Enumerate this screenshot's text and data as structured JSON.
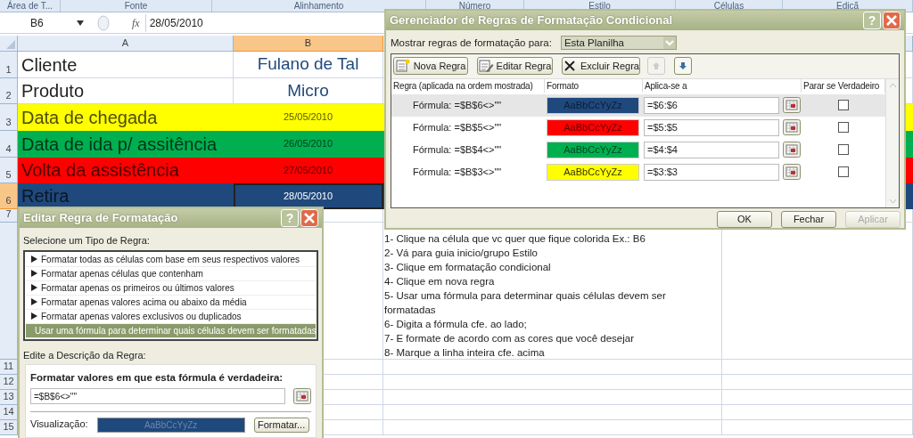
{
  "ribbon_groups": [
    {
      "label": "Área de T..."
    },
    {
      "label": "Fonte"
    },
    {
      "label": "Alinhamento"
    },
    {
      "label": "Número"
    },
    {
      "label": "Estilo"
    },
    {
      "label": "Células"
    },
    {
      "label": "Ediçã"
    }
  ],
  "formula_bar": {
    "name_box": "B6",
    "function_symbol": "fx",
    "value": "28/05/2010"
  },
  "columns": [
    {
      "label": "A",
      "selected": false
    },
    {
      "label": "B",
      "selected": true
    }
  ],
  "rows": [
    {
      "number": "1",
      "kind": "text",
      "cells": [
        "Cliente",
        "Fulano de Tal"
      ],
      "selected": false
    },
    {
      "number": "2",
      "kind": "text",
      "cells": [
        "Produto",
        "Micro"
      ],
      "selected": false
    },
    {
      "number": "3",
      "kind": "date",
      "cells": [
        "Data de chegada",
        "25/05/2010"
      ],
      "color": "#ffff00",
      "selected": false
    },
    {
      "number": "4",
      "kind": "date",
      "cells": [
        "Data de ida p/ assitência",
        "26/05/2010"
      ],
      "color": "#00b050",
      "selected": false
    },
    {
      "number": "5",
      "kind": "date",
      "cells": [
        "Volta da assistência",
        "27/05/2010"
      ],
      "color": "#ff0000",
      "selected": false
    },
    {
      "number": "6",
      "kind": "date",
      "cells": [
        "Retira",
        "28/05/2010"
      ],
      "color": "#1f497d",
      "selected": true
    },
    {
      "number": "7",
      "kind": "empty",
      "selected": false
    },
    {
      "kind": "notes",
      "selected": false,
      "notes": [
        "1- Clique na célula que vc quer que fique colorida Ex.: B6",
        "2- Vá para guia inicio/grupo Estilo",
        "3- Clique em formatação condicional",
        "4- Clique em nova regra",
        "5- Usar uma fórmula para determinar quais células devem ser formatadas",
        "6- Digita a fórmula cfe. ao lado;",
        "7- E formate de acordo com as cores que você desejar",
        "8- Marque a linha inteira cfe. acima"
      ]
    },
    {
      "number": "11",
      "kind": "empty",
      "selected": false
    },
    {
      "number": "12",
      "kind": "empty",
      "selected": false
    },
    {
      "number": "13",
      "kind": "empty",
      "selected": false
    },
    {
      "number": "14",
      "kind": "empty",
      "selected": false
    },
    {
      "number": "15",
      "kind": "empty",
      "selected": false
    }
  ],
  "rules_manager": {
    "title": "Gerenciador de Regras de Formatação Condicional",
    "help_glyph": "?",
    "show_label": "Mostrar regras de formatação para:",
    "show_value": "Esta Planilha",
    "buttons": [
      {
        "label": "Nova Regra",
        "kind": "new"
      },
      {
        "label": "Editar Regra",
        "kind": "edit"
      },
      {
        "label": "Excluir Regra",
        "kind": "delete"
      }
    ],
    "move_buttons": [
      {
        "kind": "up",
        "disabled": true
      },
      {
        "kind": "down",
        "disabled": false
      }
    ],
    "columns": [
      "Regra (aplicada na ordem mostrada)",
      "Formato",
      "Aplica-se a",
      "Parar se Verdadeiro"
    ],
    "rules": [
      {
        "rule": "Fórmula: =$B$6<>\"\"",
        "preview": "AaBbCcYyZz",
        "color": "#1f497d",
        "applies_to": "=$6:$6",
        "stop_if_true": false,
        "selected": true
      },
      {
        "rule": "Fórmula: =$B$5<>\"\"",
        "preview": "AaBbCcYyZz",
        "color": "#ff0000",
        "applies_to": "=$5:$5",
        "stop_if_true": false,
        "selected": false
      },
      {
        "rule": "Fórmula: =$B$4<>\"\"",
        "preview": "AaBbCcYyZz",
        "color": "#00b050",
        "applies_to": "=$4:$4",
        "stop_if_true": false,
        "selected": false
      },
      {
        "rule": "Fórmula: =$B$3<>\"\"",
        "preview": "AaBbCcYyZz",
        "color": "#ffff00",
        "applies_to": "=$3:$3",
        "stop_if_true": false,
        "selected": false
      }
    ],
    "footer_buttons": [
      {
        "label": "OK",
        "disabled": false
      },
      {
        "label": "Fechar",
        "disabled": false
      },
      {
        "label": "Aplicar",
        "disabled": true
      }
    ]
  },
  "edit_rule": {
    "title": "Editar Regra de Formatação",
    "help_glyph": "?",
    "select_label": "Selecione um Tipo de Regra:",
    "rule_types": [
      {
        "label": "Formatar todas as células com base em seus respectivos valores",
        "selected": false
      },
      {
        "label": "Formatar apenas células que contenham",
        "selected": false
      },
      {
        "label": "Formatar apenas os primeiros ou últimos valores",
        "selected": false
      },
      {
        "label": "Formatar apenas valores acima ou abaixo da média",
        "selected": false
      },
      {
        "label": "Formatar apenas valores exclusivos ou duplicados",
        "selected": false
      },
      {
        "label": "Usar uma fórmula para determinar quais células devem ser formatadas",
        "selected": true
      }
    ],
    "description_label": "Edite a Descrição da Regra:",
    "formula_label": "Formatar valores em que esta fórmula é verdadeira:",
    "formula": "=$B$6<>\"\"",
    "preview_label": "Visualização:",
    "preview_text": "AaBbCcYyZz",
    "format_button": "Formatar..."
  }
}
